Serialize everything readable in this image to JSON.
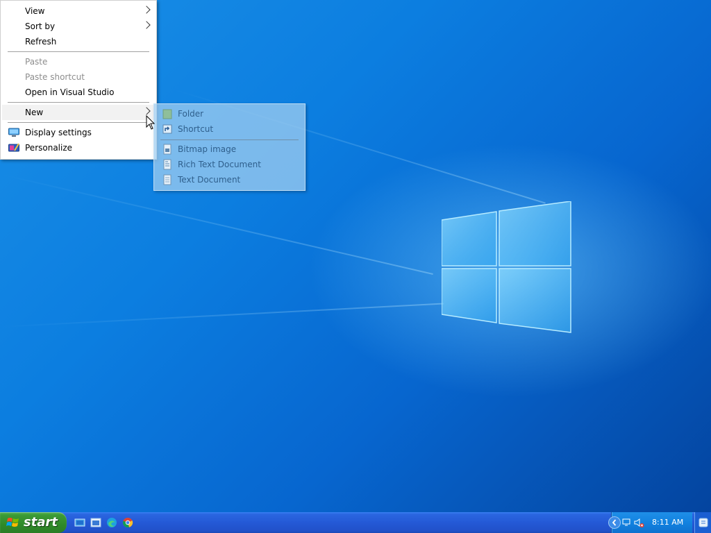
{
  "context_menu": {
    "items": [
      {
        "label": "View",
        "has_submenu": true,
        "enabled": true
      },
      {
        "label": "Sort by",
        "has_submenu": true,
        "enabled": true
      },
      {
        "label": "Refresh",
        "has_submenu": false,
        "enabled": true
      },
      {
        "label": "Paste",
        "has_submenu": false,
        "enabled": false
      },
      {
        "label": "Paste shortcut",
        "has_submenu": false,
        "enabled": false
      },
      {
        "label": "Open in Visual Studio",
        "has_submenu": false,
        "enabled": true
      },
      {
        "label": "New",
        "has_submenu": true,
        "enabled": true,
        "highlighted": true
      },
      {
        "label": "Display settings",
        "icon": "display-icon",
        "enabled": true
      },
      {
        "label": "Personalize",
        "icon": "personalize-icon",
        "enabled": true
      }
    ]
  },
  "new_submenu": {
    "items": [
      {
        "label": "Folder",
        "icon": "folder-icon"
      },
      {
        "label": "Shortcut",
        "icon": "shortcut-icon"
      },
      {
        "label": "Bitmap image",
        "icon": "bitmap-icon"
      },
      {
        "label": "Rich Text Document",
        "icon": "rtf-document-icon"
      },
      {
        "label": "Text Document",
        "icon": "text-document-icon"
      }
    ]
  },
  "taskbar": {
    "start_label": "start",
    "quick_launch": [
      "show-desktop-icon",
      "explorer-icon",
      "edge-icon",
      "chrome-icon"
    ],
    "tray_icons": [
      "tray-expand-icon",
      "network-disconnected-icon",
      "volume-muted-icon"
    ],
    "clock": "8:11 AM"
  },
  "colors": {
    "desktop_blue": "#0c7ee0",
    "taskbar_blue": "#2459d6",
    "start_green": "#2f8a2a",
    "submenu_text": "#2f5f8c"
  }
}
